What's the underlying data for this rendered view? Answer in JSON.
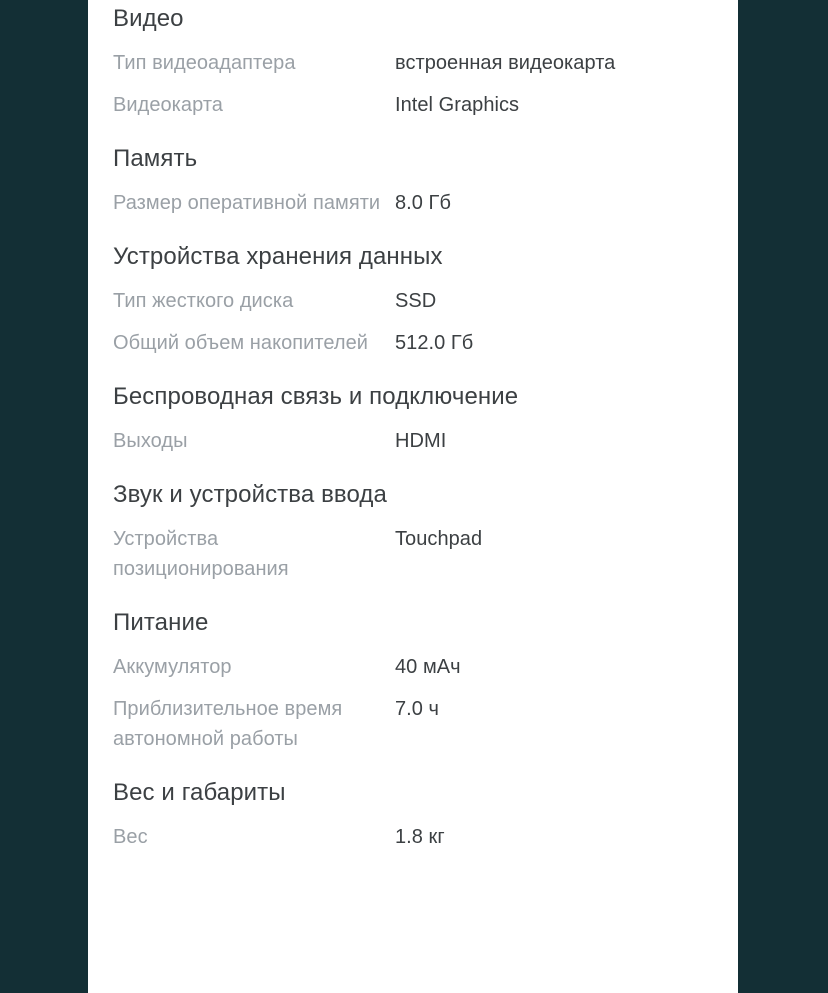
{
  "theme": {
    "page_background": "#132f35",
    "panel_background": "#ffffff",
    "heading_color": "#3c4043",
    "label_color": "#9aa0a6",
    "value_color": "#3c4043"
  },
  "specs": {
    "sections": [
      {
        "heading": "Видео",
        "rows": [
          {
            "label": "Тип видеоадаптера",
            "value": "встроенная видеокарта"
          },
          {
            "label": "Видеокарта",
            "value": "Intel Graphics"
          }
        ]
      },
      {
        "heading": "Память",
        "rows": [
          {
            "label": "Размер оперативной памяти",
            "value": "8.0 Гб"
          }
        ]
      },
      {
        "heading": "Устройства хранения данных",
        "rows": [
          {
            "label": "Тип жесткого диска",
            "value": "SSD"
          },
          {
            "label": "Общий объем накопителей",
            "value": "512.0 Гб"
          }
        ]
      },
      {
        "heading": "Беспроводная связь и подключение",
        "rows": [
          {
            "label": "Выходы",
            "value": "HDMI"
          }
        ]
      },
      {
        "heading": "Звук и устройства ввода",
        "rows": [
          {
            "label": "Устройства позиционирования",
            "value": "Touchpad"
          }
        ]
      },
      {
        "heading": "Питание",
        "rows": [
          {
            "label": "Аккумулятор",
            "value": "40 мАч"
          },
          {
            "label": "Приблизительное время автономной работы",
            "value": "7.0 ч"
          }
        ]
      },
      {
        "heading": "Вес и габариты",
        "rows": [
          {
            "label": "Вес",
            "value": "1.8 кг"
          }
        ]
      }
    ]
  }
}
